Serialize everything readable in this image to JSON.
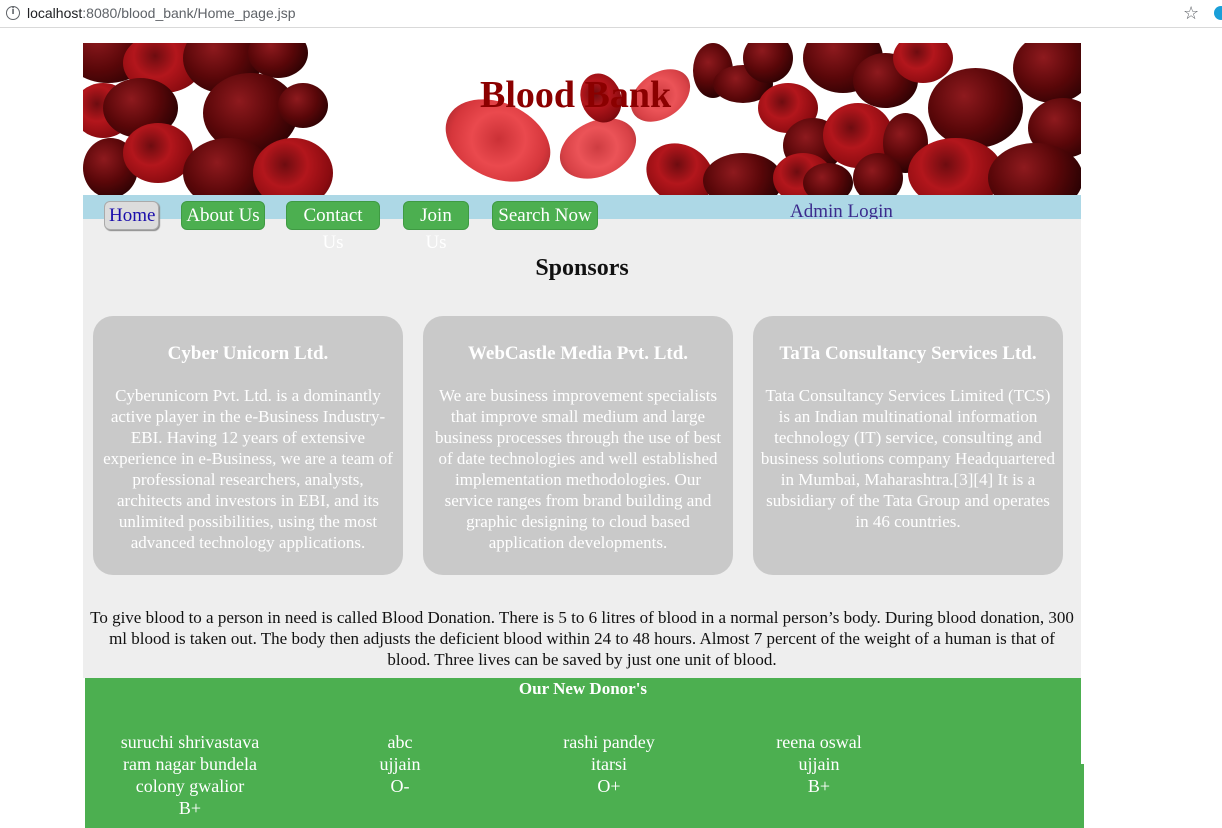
{
  "browser": {
    "url_host": "localhost",
    "url_rest": ":8080/blood_bank/Home_page.jsp"
  },
  "banner": {
    "title": "Blood Bank"
  },
  "nav": {
    "home": "Home",
    "about": "About Us",
    "contact": "Contact Us",
    "join": "Join Us",
    "search": "Search Now",
    "admin": "Admin Login"
  },
  "sponsors": {
    "heading": "Sponsors",
    "cards": [
      {
        "title": "Cyber Unicorn Ltd.",
        "text": "Cyberunicorn Pvt. Ltd. is a dominantly active player in the e-Business Industry-EBI. Having 12 years of extensive experience in e-Business, we are a team of professional researchers, analysts, architects and investors in EBI, and its unlimited possibilities, using the most advanced technology applications."
      },
      {
        "title": "WebCastle Media Pvt. Ltd.",
        "text": "We are business improvement specialists that improve small medium and large business processes through the use of best of date technologies and well established implementation methodologies. Our service ranges from brand building and graphic designing to cloud based application developments."
      },
      {
        "title": "TaTa Consultancy Services Ltd.",
        "text": "Tata Consultancy Services Limited (TCS) is an Indian multinational information technology (IT) service, consulting and business solutions company Headquartered in Mumbai, Maharashtra.[3][4] It is a subsidiary of the Tata Group and operates in 46 countries."
      }
    ]
  },
  "blurb": "To give blood to a person in need is called Blood Donation. There is 5 to 6 litres of blood in a normal person’s body. During blood donation, 300 ml blood is taken out. The body then adjusts the deficient blood within 24 to 48 hours. Almost 7 percent of the weight of a human is that of blood. Three lives can be saved by just one unit of blood.",
  "donors": {
    "heading": "Our New Donor's",
    "list": [
      {
        "name": "suruchi shrivastava",
        "address": "ram nagar bundela colony gwalior",
        "blood_group": "B+"
      },
      {
        "name": "abc",
        "address": "ujjain",
        "blood_group": "O-"
      },
      {
        "name": "rashi pandey",
        "address": "itarsi",
        "blood_group": "O+"
      },
      {
        "name": "reena oswal",
        "address": "ujjain",
        "blood_group": "B+"
      }
    ]
  },
  "colors": {
    "nav_bg": "#add8e6",
    "button_green": "#4caf50",
    "title_red": "#8b0000",
    "card_grey": "#c9c9c9"
  }
}
